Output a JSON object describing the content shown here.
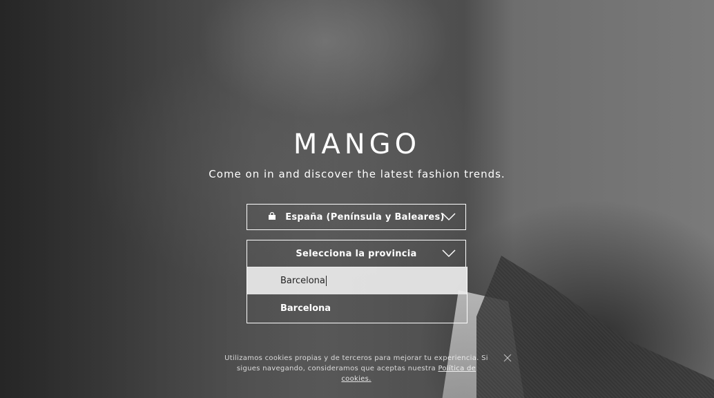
{
  "brand": {
    "logo_text": "MANGO",
    "tagline": "Come on in and discover the latest fashion trends."
  },
  "country_select": {
    "icon": "shopping-bag-icon",
    "value": "España (Península y Baleares)"
  },
  "province_select": {
    "label": "Selecciona la provincia",
    "search_value": "Barcelona",
    "options": [
      "Barcelona"
    ]
  },
  "cookie_notice": {
    "text": "Utilizamos cookies propias y de terceros para mejorar tu experiencia. Si sigues navegando, consideramos que aceptas nuestra ",
    "link_text": "Política de cookies.",
    "close_icon": "close-icon"
  },
  "colors": {
    "text": "#ffffff",
    "search_bg": "#ebebeb"
  }
}
